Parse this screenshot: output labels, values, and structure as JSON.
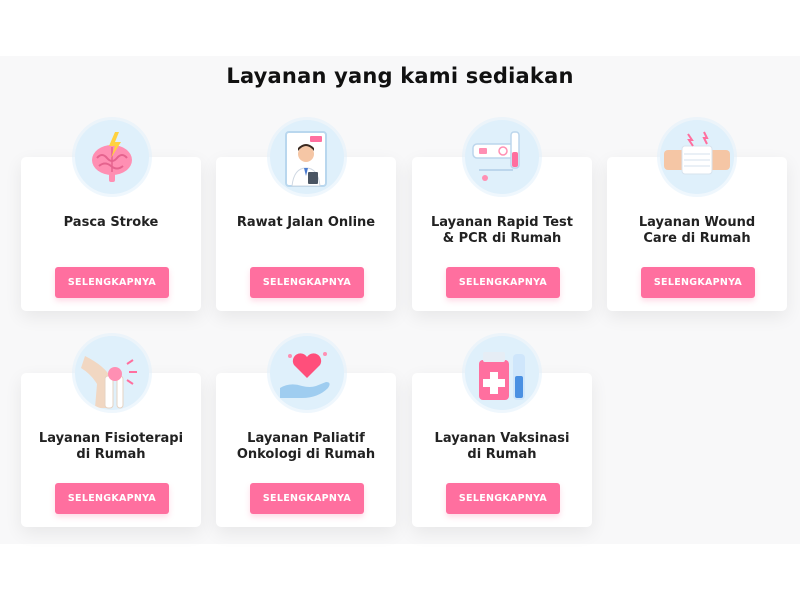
{
  "section": {
    "title": "Layanan yang kami sediakan",
    "button_label": "SELENGKAPNYA",
    "accent_color": "#ff6f9f",
    "icon_bg_color": "#dff0fb"
  },
  "services": [
    {
      "line1": "Pasca Stroke",
      "line2": "",
      "icon": "brain-icon"
    },
    {
      "line1": "Rawat Jalan Online",
      "line2": "",
      "icon": "doctor-live-icon"
    },
    {
      "line1": "Layanan Rapid Test",
      "line2": "& PCR di Rumah",
      "icon": "rapid-test-icon"
    },
    {
      "line1": "Layanan Wound",
      "line2": "Care di Rumah",
      "icon": "bandage-icon"
    },
    {
      "line1": "Layanan Fisioterapi",
      "line2": "di Rumah",
      "icon": "knee-joint-icon"
    },
    {
      "line1": "Layanan Paliatif",
      "line2": "Onkologi di Rumah",
      "icon": "heart-hand-icon"
    },
    {
      "line1": "Layanan Vaksinasi",
      "line2": "di Rumah",
      "icon": "vaccine-icon"
    }
  ]
}
